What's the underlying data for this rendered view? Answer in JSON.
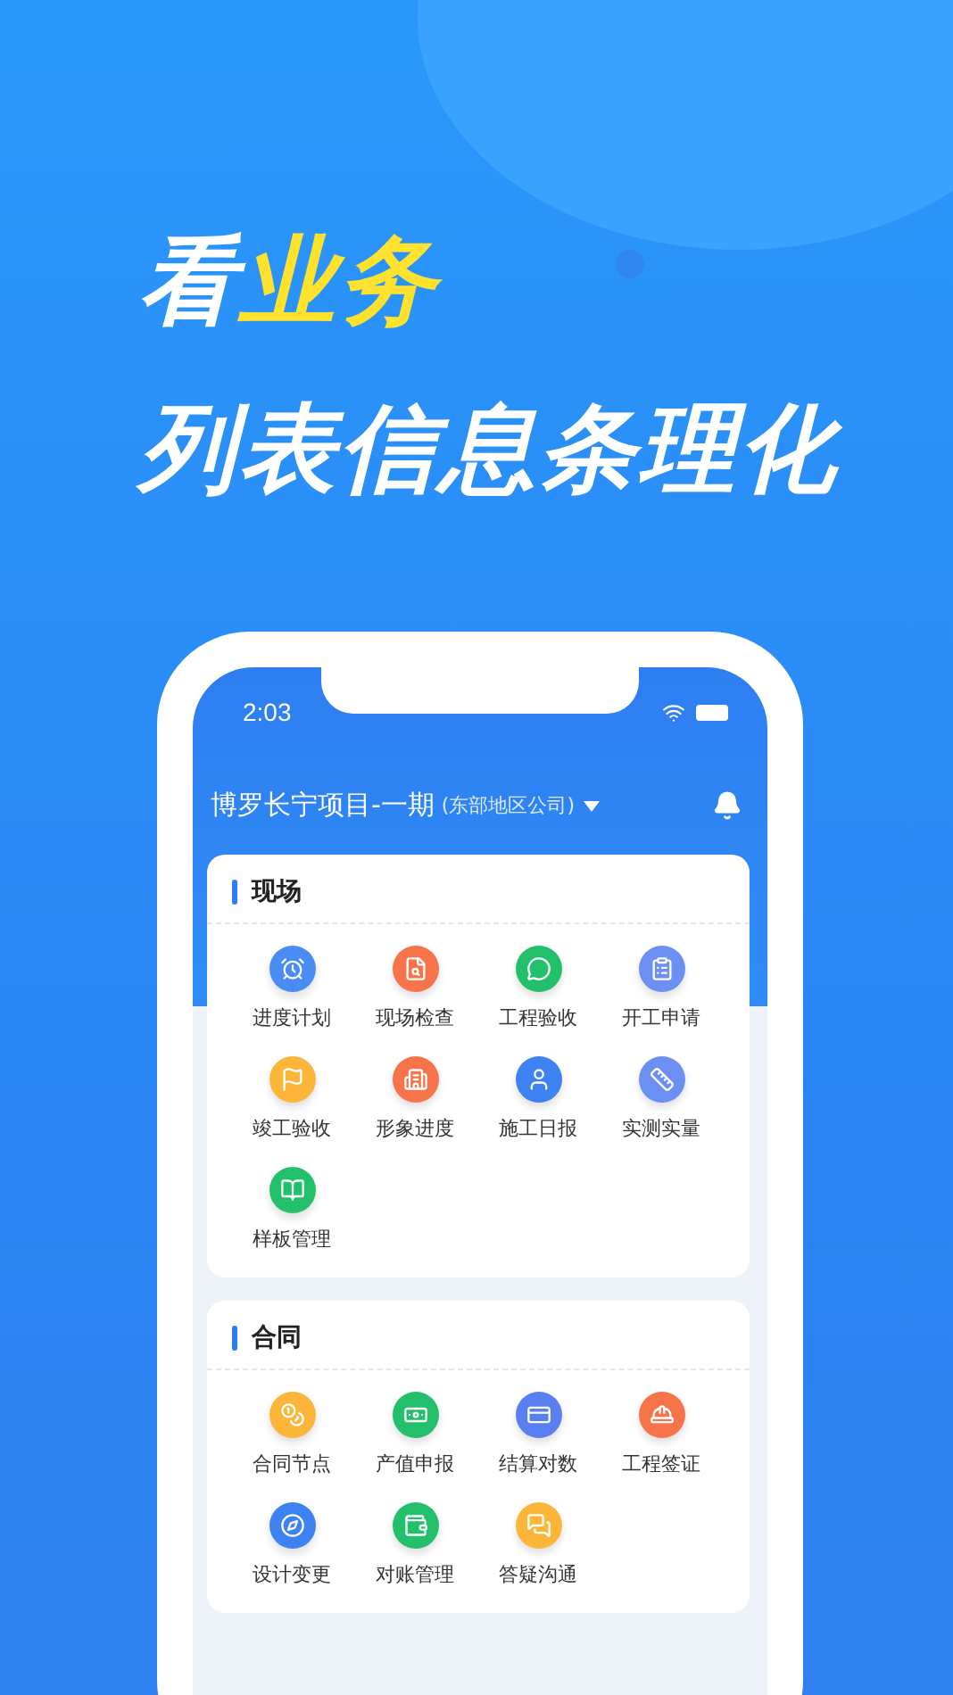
{
  "headline": {
    "line_1": [
      {
        "text": "看",
        "highlight": false
      },
      {
        "text": "业务",
        "highlight": true
      }
    ],
    "line_2": "列表信息条理化"
  },
  "phone": {
    "status_bar": {
      "time": "2:03"
    },
    "project": {
      "name": "博罗长宁项目-一期",
      "company": "(东部地区公司)"
    },
    "sections": [
      {
        "title": "现场",
        "items": [
          {
            "label": "进度计划",
            "color": "#4a8cf6"
          },
          {
            "label": "现场检查",
            "color": "#f7744a"
          },
          {
            "label": "工程验收",
            "color": "#22c06a"
          },
          {
            "label": "开工申请",
            "color": "#6b8ff2"
          },
          {
            "label": "竣工验收",
            "color": "#fbb63a"
          },
          {
            "label": "形象进度",
            "color": "#f7744a"
          },
          {
            "label": "施工日报",
            "color": "#3d82f2"
          },
          {
            "label": "实测实量",
            "color": "#6b8ff2"
          },
          {
            "label": "样板管理",
            "color": "#22c06a"
          }
        ]
      },
      {
        "title": "合同",
        "items": [
          {
            "label": "合同节点",
            "color": "#fbb63a"
          },
          {
            "label": "产值申报",
            "color": "#22c06a"
          },
          {
            "label": "结算对数",
            "color": "#5a7ff0"
          },
          {
            "label": "工程签证",
            "color": "#f7744a"
          },
          {
            "label": "设计变更",
            "color": "#3d82f2"
          },
          {
            "label": "对账管理",
            "color": "#22c06a"
          },
          {
            "label": "答疑沟通",
            "color": "#fbb63a"
          }
        ]
      }
    ]
  }
}
